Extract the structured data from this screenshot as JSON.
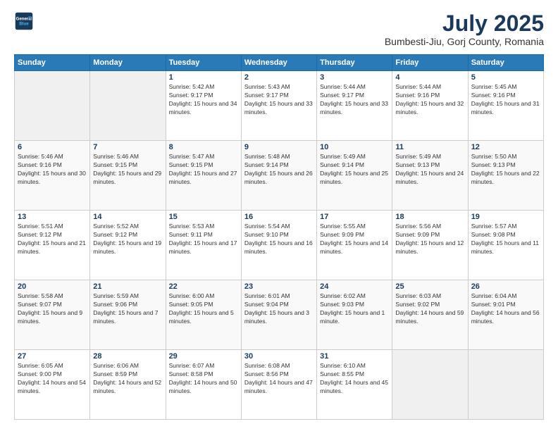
{
  "logo": {
    "line1": "General",
    "line2": "Blue"
  },
  "title": "July 2025",
  "location": "Bumbesti-Jiu, Gorj County, Romania",
  "weekdays": [
    "Sunday",
    "Monday",
    "Tuesday",
    "Wednesday",
    "Thursday",
    "Friday",
    "Saturday"
  ],
  "days": [
    {
      "date": "",
      "info": ""
    },
    {
      "date": "",
      "info": ""
    },
    {
      "date": "1",
      "info": "Sunrise: 5:42 AM\nSunset: 9:17 PM\nDaylight: 15 hours and 34 minutes."
    },
    {
      "date": "2",
      "info": "Sunrise: 5:43 AM\nSunset: 9:17 PM\nDaylight: 15 hours and 33 minutes."
    },
    {
      "date": "3",
      "info": "Sunrise: 5:44 AM\nSunset: 9:17 PM\nDaylight: 15 hours and 33 minutes."
    },
    {
      "date": "4",
      "info": "Sunrise: 5:44 AM\nSunset: 9:16 PM\nDaylight: 15 hours and 32 minutes."
    },
    {
      "date": "5",
      "info": "Sunrise: 5:45 AM\nSunset: 9:16 PM\nDaylight: 15 hours and 31 minutes."
    },
    {
      "date": "6",
      "info": "Sunrise: 5:46 AM\nSunset: 9:16 PM\nDaylight: 15 hours and 30 minutes."
    },
    {
      "date": "7",
      "info": "Sunrise: 5:46 AM\nSunset: 9:15 PM\nDaylight: 15 hours and 29 minutes."
    },
    {
      "date": "8",
      "info": "Sunrise: 5:47 AM\nSunset: 9:15 PM\nDaylight: 15 hours and 27 minutes."
    },
    {
      "date": "9",
      "info": "Sunrise: 5:48 AM\nSunset: 9:14 PM\nDaylight: 15 hours and 26 minutes."
    },
    {
      "date": "10",
      "info": "Sunrise: 5:49 AM\nSunset: 9:14 PM\nDaylight: 15 hours and 25 minutes."
    },
    {
      "date": "11",
      "info": "Sunrise: 5:49 AM\nSunset: 9:13 PM\nDaylight: 15 hours and 24 minutes."
    },
    {
      "date": "12",
      "info": "Sunrise: 5:50 AM\nSunset: 9:13 PM\nDaylight: 15 hours and 22 minutes."
    },
    {
      "date": "13",
      "info": "Sunrise: 5:51 AM\nSunset: 9:12 PM\nDaylight: 15 hours and 21 minutes."
    },
    {
      "date": "14",
      "info": "Sunrise: 5:52 AM\nSunset: 9:12 PM\nDaylight: 15 hours and 19 minutes."
    },
    {
      "date": "15",
      "info": "Sunrise: 5:53 AM\nSunset: 9:11 PM\nDaylight: 15 hours and 17 minutes."
    },
    {
      "date": "16",
      "info": "Sunrise: 5:54 AM\nSunset: 9:10 PM\nDaylight: 15 hours and 16 minutes."
    },
    {
      "date": "17",
      "info": "Sunrise: 5:55 AM\nSunset: 9:09 PM\nDaylight: 15 hours and 14 minutes."
    },
    {
      "date": "18",
      "info": "Sunrise: 5:56 AM\nSunset: 9:09 PM\nDaylight: 15 hours and 12 minutes."
    },
    {
      "date": "19",
      "info": "Sunrise: 5:57 AM\nSunset: 9:08 PM\nDaylight: 15 hours and 11 minutes."
    },
    {
      "date": "20",
      "info": "Sunrise: 5:58 AM\nSunset: 9:07 PM\nDaylight: 15 hours and 9 minutes."
    },
    {
      "date": "21",
      "info": "Sunrise: 5:59 AM\nSunset: 9:06 PM\nDaylight: 15 hours and 7 minutes."
    },
    {
      "date": "22",
      "info": "Sunrise: 6:00 AM\nSunset: 9:05 PM\nDaylight: 15 hours and 5 minutes."
    },
    {
      "date": "23",
      "info": "Sunrise: 6:01 AM\nSunset: 9:04 PM\nDaylight: 15 hours and 3 minutes."
    },
    {
      "date": "24",
      "info": "Sunrise: 6:02 AM\nSunset: 9:03 PM\nDaylight: 15 hours and 1 minute."
    },
    {
      "date": "25",
      "info": "Sunrise: 6:03 AM\nSunset: 9:02 PM\nDaylight: 14 hours and 59 minutes."
    },
    {
      "date": "26",
      "info": "Sunrise: 6:04 AM\nSunset: 9:01 PM\nDaylight: 14 hours and 56 minutes."
    },
    {
      "date": "27",
      "info": "Sunrise: 6:05 AM\nSunset: 9:00 PM\nDaylight: 14 hours and 54 minutes."
    },
    {
      "date": "28",
      "info": "Sunrise: 6:06 AM\nSunset: 8:59 PM\nDaylight: 14 hours and 52 minutes."
    },
    {
      "date": "29",
      "info": "Sunrise: 6:07 AM\nSunset: 8:58 PM\nDaylight: 14 hours and 50 minutes."
    },
    {
      "date": "30",
      "info": "Sunrise: 6:08 AM\nSunset: 8:56 PM\nDaylight: 14 hours and 47 minutes."
    },
    {
      "date": "31",
      "info": "Sunrise: 6:10 AM\nSunset: 8:55 PM\nDaylight: 14 hours and 45 minutes."
    },
    {
      "date": "",
      "info": ""
    },
    {
      "date": "",
      "info": ""
    },
    {
      "date": "",
      "info": ""
    },
    {
      "date": "",
      "info": ""
    }
  ]
}
